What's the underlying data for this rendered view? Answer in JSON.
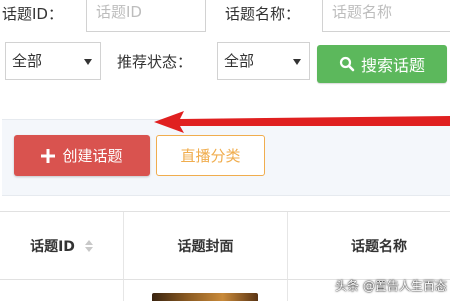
{
  "filters": {
    "topic_id_label": "话题ID：",
    "topic_id_placeholder": "话题ID",
    "topic_name_label": "话题名称：",
    "topic_name_placeholder": "话题名称",
    "category_select_value": "全部",
    "recommend_status_label": "推荐状态：",
    "recommend_select_value": "全部",
    "search_button_label": "搜索话题"
  },
  "toolbar": {
    "create_button_label": "创建话题",
    "live_category_button_label": "直播分类"
  },
  "table": {
    "columns": [
      "话题ID",
      "话题封面",
      "话题名称"
    ]
  },
  "watermark": {
    "text": "头条 @置告人生百态"
  },
  "colors": {
    "green": "#5cb85c",
    "red": "#d9534f",
    "orange": "#f0ad4e",
    "arrow": "#e02020"
  },
  "icons": {
    "search": "search-icon",
    "plus": "plus-icon",
    "sort": "sort-icon"
  }
}
